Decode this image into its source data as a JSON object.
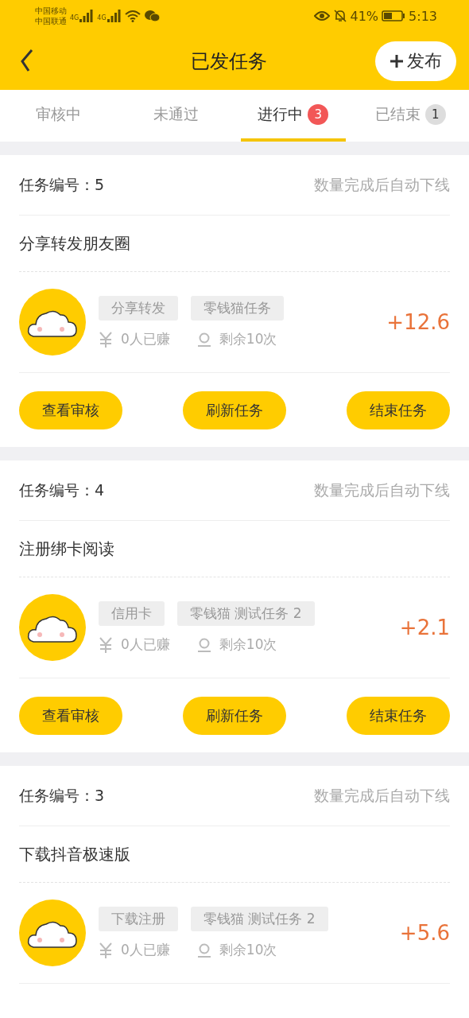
{
  "status_bar": {
    "carriers": [
      "中国移动",
      "中国联通"
    ],
    "networks": [
      "4G",
      "4G"
    ],
    "battery": "41%",
    "time": "5:13"
  },
  "header": {
    "title": "已发任务",
    "publish_button": "发布"
  },
  "tabs": [
    {
      "label": "审核中",
      "selected": false
    },
    {
      "label": "未通过",
      "selected": false
    },
    {
      "label": "进行中",
      "selected": true,
      "badge": "3"
    },
    {
      "label": "已结束",
      "selected": false,
      "badge": "1"
    }
  ],
  "tasks": [
    {
      "number": "任务编号：5",
      "note": "数量完成后自动下线",
      "title": "分享转发朋友圈",
      "tags": [
        "分享转发",
        "零钱猫任务"
      ],
      "earned": "0人已赚",
      "remaining": "剩余10次",
      "reward": "+12.6",
      "buttons": [
        "查看审核",
        "刷新任务",
        "结束任务"
      ]
    },
    {
      "number": "任务编号：4",
      "note": "数量完成后自动下线",
      "title": "注册绑卡阅读",
      "tags": [
        "信用卡",
        "零钱猫 测试任务 2"
      ],
      "earned": "0人已赚",
      "remaining": "剩余10次",
      "reward": "+2.1",
      "buttons": [
        "查看审核",
        "刷新任务",
        "结束任务"
      ]
    },
    {
      "number": "任务编号：3",
      "note": "数量完成后自动下线",
      "title": "下载抖音极速版",
      "tags": [
        "下载注册",
        "零钱猫 测试任务 2"
      ],
      "earned": "0人已赚",
      "remaining": "剩余10次",
      "reward": "+5.6"
    }
  ]
}
